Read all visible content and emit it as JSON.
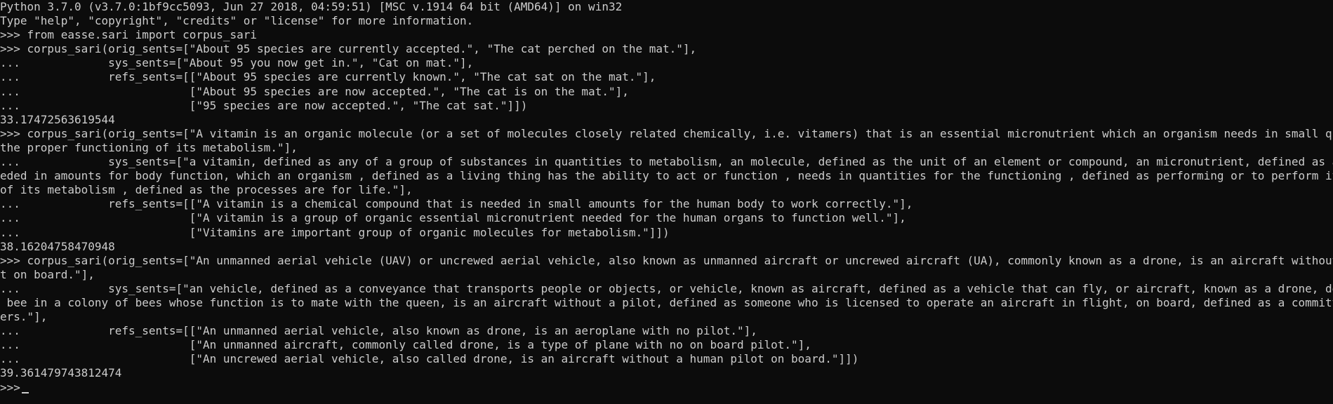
{
  "colors": {
    "background": "#0c0c0c",
    "text": "#cccccc"
  },
  "console": {
    "lines": [
      "Python 3.7.0 (v3.7.0:1bf9cc5093, Jun 27 2018, 04:59:51) [MSC v.1914 64 bit (AMD64)] on win32",
      "Type \"help\", \"copyright\", \"credits\" or \"license\" for more information.",
      ">>> from easse.sari import corpus_sari",
      ">>> corpus_sari(orig_sents=[\"About 95 species are currently accepted.\", \"The cat perched on the mat.\"],",
      "...             sys_sents=[\"About 95 you now get in.\", \"Cat on mat.\"],",
      "...             refs_sents=[[\"About 95 species are currently known.\", \"The cat sat on the mat.\"],",
      "...                         [\"About 95 species are now accepted.\", \"The cat is on the mat.\"],",
      "...                         [\"95 species are now accepted.\", \"The cat sat.\"]])",
      "33.17472563619544",
      ">>> corpus_sari(orig_sents=[\"A vitamin is an organic molecule (or a set of molecules closely related chemically, i.e. vitamers) that is an essential micronutrient which an organism needs in small quantities for",
      "the proper functioning of its metabolism.\"],",
      "...             sys_sents=[\"a vitamin, defined as any of a group of substances in quantities to metabolism, an molecule, defined as the unit of an element or compound, an micronutrient, defined as a substance ne",
      "eded in amounts for body function, which an organism , defined as a living thing has the ability to act or function , needs in quantities for the functioning , defined as performing or to perform its function ,",
      "of its metabolism , defined as the processes are for life.\"],",
      "...             refs_sents=[[\"A vitamin is a chemical compound that is needed in small amounts for the human body to work correctly.\"],",
      "...                         [\"A vitamin is a group of organic essential micronutrient needed for the human organs to function well.\"],",
      "...                         [\"Vitamins are important group of organic molecules for metabolism.\"]])",
      "38.16204758470948",
      ">>> corpus_sari(orig_sents=[\"An unmanned aerial vehicle (UAV) or uncrewed aerial vehicle, also known as unmanned aircraft or uncrewed aircraft (UA), commonly known as a drone, is an aircraft without a human pilo",
      "t on board.\"],",
      "...             sys_sents=[\"an vehicle, defined as a conveyance that transports people or objects, or vehicle, known as aircraft, defined as a vehicle that can fly, or aircraft, known as a drone, defined as male",
      " bee in a colony of bees whose function is to mate with the queen, is an aircraft without a pilot, defined as someone who is licensed to operate an aircraft in flight, on board, defined as a committee having pow",
      "ers.\"],",
      "...             refs_sents=[[\"An unmanned aerial vehicle, also known as drone, is an aeroplane with no pilot.\"],",
      "...                         [\"An unmanned aircraft, commonly called drone, is a type of plane with no on board pilot.\"],",
      "...                         [\"An uncrewed aerial vehicle, also called drone, is an aircraft without a human pilot on board.\"]])",
      "39.361479743812474"
    ],
    "prompt": ">>>"
  }
}
